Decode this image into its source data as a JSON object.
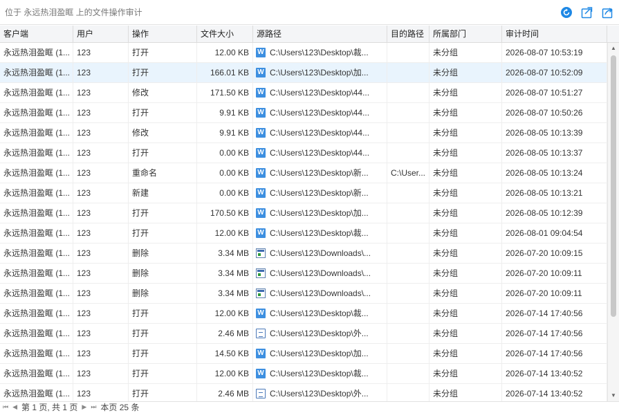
{
  "titlebar": {
    "title": "位于 永远热泪盈眶 上的文件操作审计",
    "icons": [
      "refresh-icon",
      "export-icon",
      "share-icon"
    ],
    "accent": "#1e88e5"
  },
  "columns": [
    "客户端",
    "用户",
    "操作",
    "文件大小",
    "源路径",
    "目的路径",
    "所属部门",
    "审计时间"
  ],
  "rows": [
    {
      "client": "永远热泪盈眶 (1...",
      "user": "123",
      "op": "打开",
      "size": "12.00 KB",
      "icon": "word",
      "src": "C:\\Users\\123\\Desktop\\裁...",
      "dst": "",
      "dept": "未分组",
      "time": "2026-08-07 10:53:19"
    },
    {
      "client": "永远热泪盈眶 (1...",
      "user": "123",
      "op": "打开",
      "size": "166.01 KB",
      "icon": "word",
      "src": "C:\\Users\\123\\Desktop\\加...",
      "dst": "",
      "dept": "未分组",
      "time": "2026-08-07 10:52:09",
      "selected": true
    },
    {
      "client": "永远热泪盈眶 (1...",
      "user": "123",
      "op": "修改",
      "size": "171.50 KB",
      "icon": "word",
      "src": "C:\\Users\\123\\Desktop\\44...",
      "dst": "",
      "dept": "未分组",
      "time": "2026-08-07 10:51:27"
    },
    {
      "client": "永远热泪盈眶 (1...",
      "user": "123",
      "op": "打开",
      "size": "9.91 KB",
      "icon": "word",
      "src": "C:\\Users\\123\\Desktop\\44...",
      "dst": "",
      "dept": "未分组",
      "time": "2026-08-07 10:50:26"
    },
    {
      "client": "永远热泪盈眶 (1...",
      "user": "123",
      "op": "修改",
      "size": "9.91 KB",
      "icon": "word",
      "src": "C:\\Users\\123\\Desktop\\44...",
      "dst": "",
      "dept": "未分组",
      "time": "2026-08-05 10:13:39"
    },
    {
      "client": "永远热泪盈眶 (1...",
      "user": "123",
      "op": "打开",
      "size": "0.00 KB",
      "icon": "word",
      "src": "C:\\Users\\123\\Desktop\\44...",
      "dst": "",
      "dept": "未分组",
      "time": "2026-08-05 10:13:37"
    },
    {
      "client": "永远热泪盈眶 (1...",
      "user": "123",
      "op": "重命名",
      "size": "0.00 KB",
      "icon": "word",
      "src": "C:\\Users\\123\\Desktop\\新...",
      "dst": "C:\\User...",
      "dept": "未分组",
      "time": "2026-08-05 10:13:24"
    },
    {
      "client": "永远热泪盈眶 (1...",
      "user": "123",
      "op": "新建",
      "size": "0.00 KB",
      "icon": "word",
      "src": "C:\\Users\\123\\Desktop\\新...",
      "dst": "",
      "dept": "未分组",
      "time": "2026-08-05 10:13:21"
    },
    {
      "client": "永远热泪盈眶 (1...",
      "user": "123",
      "op": "打开",
      "size": "170.50 KB",
      "icon": "word",
      "src": "C:\\Users\\123\\Desktop\\加...",
      "dst": "",
      "dept": "未分组",
      "time": "2026-08-05 10:12:39"
    },
    {
      "client": "永远热泪盈眶 (1...",
      "user": "123",
      "op": "打开",
      "size": "12.00 KB",
      "icon": "word",
      "src": "C:\\Users\\123\\Desktop\\裁...",
      "dst": "",
      "dept": "未分组",
      "time": "2026-08-01 09:04:54"
    },
    {
      "client": "永远热泪盈眶 (1...",
      "user": "123",
      "op": "删除",
      "size": "3.34 MB",
      "icon": "exe",
      "src": "C:\\Users\\123\\Downloads\\...",
      "dst": "",
      "dept": "未分组",
      "time": "2026-07-20 10:09:15"
    },
    {
      "client": "永远热泪盈眶 (1...",
      "user": "123",
      "op": "删除",
      "size": "3.34 MB",
      "icon": "exe",
      "src": "C:\\Users\\123\\Downloads\\...",
      "dst": "",
      "dept": "未分组",
      "time": "2026-07-20 10:09:11"
    },
    {
      "client": "永远热泪盈眶 (1...",
      "user": "123",
      "op": "删除",
      "size": "3.34 MB",
      "icon": "exe",
      "src": "C:\\Users\\123\\Downloads\\...",
      "dst": "",
      "dept": "未分组",
      "time": "2026-07-20 10:09:11"
    },
    {
      "client": "永远热泪盈眶 (1...",
      "user": "123",
      "op": "打开",
      "size": "12.00 KB",
      "icon": "word",
      "src": "C:\\Users\\123\\Desktop\\裁...",
      "dst": "",
      "dept": "未分组",
      "time": "2026-07-14 17:40:56"
    },
    {
      "client": "永远热泪盈眶 (1...",
      "user": "123",
      "op": "打开",
      "size": "2.46 MB",
      "icon": "doc",
      "src": "C:\\Users\\123\\Desktop\\外...",
      "dst": "",
      "dept": "未分组",
      "time": "2026-07-14 17:40:56"
    },
    {
      "client": "永远热泪盈眶 (1...",
      "user": "123",
      "op": "打开",
      "size": "14.50 KB",
      "icon": "word",
      "src": "C:\\Users\\123\\Desktop\\加...",
      "dst": "",
      "dept": "未分组",
      "time": "2026-07-14 17:40:56"
    },
    {
      "client": "永远热泪盈眶 (1...",
      "user": "123",
      "op": "打开",
      "size": "12.00 KB",
      "icon": "word",
      "src": "C:\\Users\\123\\Desktop\\裁...",
      "dst": "",
      "dept": "未分组",
      "time": "2026-07-14 13:40:52"
    },
    {
      "client": "永远热泪盈眶 (1...",
      "user": "123",
      "op": "打开",
      "size": "2.46 MB",
      "icon": "doc",
      "src": "C:\\Users\\123\\Desktop\\外...",
      "dst": "",
      "dept": "未分组",
      "time": "2026-07-14 13:40:52"
    }
  ],
  "footer": {
    "page_info": "第 1 页, 共 1 页",
    "count_info": "本页 25 条"
  }
}
